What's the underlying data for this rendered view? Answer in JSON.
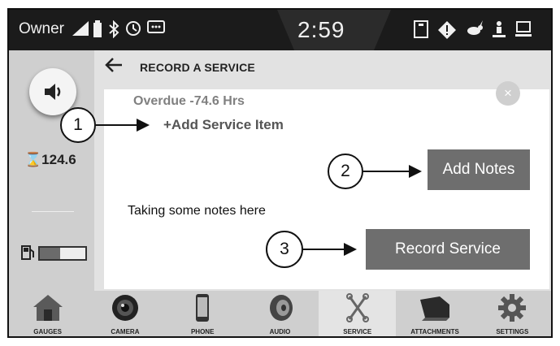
{
  "status_bar": {
    "user": "Owner",
    "clock": "2:59"
  },
  "left_panel": {
    "hour_meter": "124.6",
    "fuel_level_fraction": 0.45
  },
  "header": {
    "title": "RECORD A SERVICE"
  },
  "card": {
    "overdue_text": "Overdue -74.6 Hrs",
    "add_service_item_label": "+Add Service Item",
    "add_notes_label": "Add Notes",
    "notes_text": "Taking some notes here",
    "record_service_label": "Record Service",
    "close_icon_glyph": "×"
  },
  "callouts": [
    "1",
    "2",
    "3"
  ],
  "bottom_nav": [
    {
      "label": "GAUGES",
      "icon": "house-icon"
    },
    {
      "label": "CAMERA",
      "icon": "camera-icon"
    },
    {
      "label": "PHONE",
      "icon": "phone-icon"
    },
    {
      "label": "AUDIO",
      "icon": "speaker-icon"
    },
    {
      "label": "SERVICE",
      "icon": "wrench-icon",
      "active": true
    },
    {
      "label": "ATTACHMENTS",
      "icon": "bucket-icon"
    },
    {
      "label": "SETTINGS",
      "icon": "gear-icon"
    }
  ],
  "colors": {
    "status_bar": "#1b1b1b",
    "button": "#6e6e6e",
    "panel": "#cfcfcf"
  }
}
